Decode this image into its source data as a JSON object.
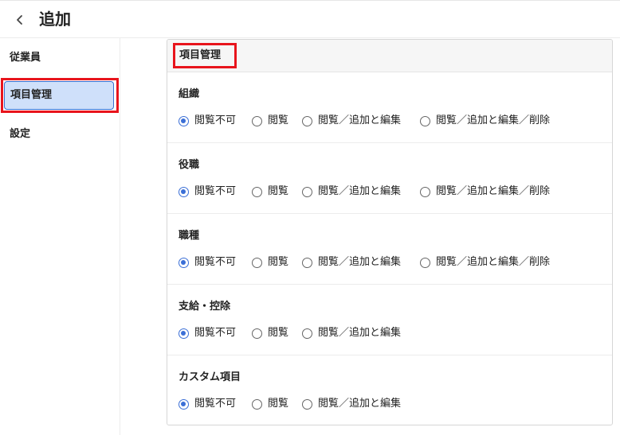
{
  "header": {
    "title": "追加"
  },
  "sidebar": {
    "items": [
      {
        "label": "従業員"
      },
      {
        "label": "項目管理",
        "active": true
      },
      {
        "label": "設定"
      }
    ]
  },
  "panel": {
    "title": "項目管理",
    "sections": [
      {
        "label": "組織",
        "options": [
          "閲覧不可",
          "閲覧",
          "閲覧／追加と編集",
          "閲覧／追加と編集／削除"
        ],
        "selected": 0
      },
      {
        "label": "役職",
        "options": [
          "閲覧不可",
          "閲覧",
          "閲覧／追加と編集",
          "閲覧／追加と編集／削除"
        ],
        "selected": 0
      },
      {
        "label": "職種",
        "options": [
          "閲覧不可",
          "閲覧",
          "閲覧／追加と編集",
          "閲覧／追加と編集／削除"
        ],
        "selected": 0
      },
      {
        "label": "支給・控除",
        "options": [
          "閲覧不可",
          "閲覧",
          "閲覧／追加と編集"
        ],
        "selected": 0
      },
      {
        "label": "カスタム項目",
        "options": [
          "閲覧不可",
          "閲覧",
          "閲覧／追加と編集"
        ],
        "selected": 0
      }
    ]
  },
  "colors": {
    "highlight": "#e8141c",
    "accent": "#3b6fd6",
    "active_bg": "#cfe0fa"
  }
}
